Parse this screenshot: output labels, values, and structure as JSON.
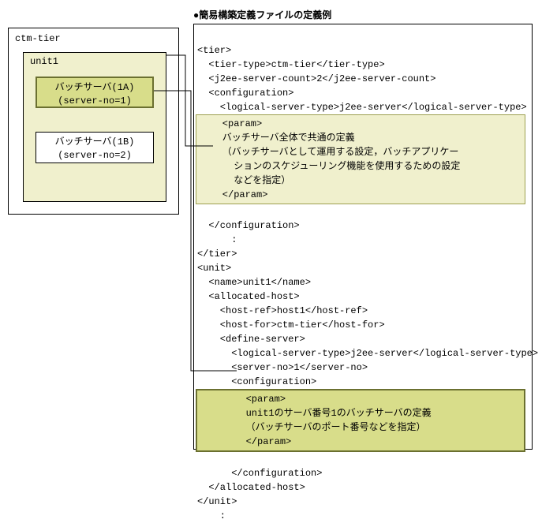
{
  "title": "●簡易構築定義ファイルの定義例",
  "diagram": {
    "ctm_label": "ctm-tier",
    "unit_label": "unit1",
    "server1_line1": "バッチサーバ(1A)",
    "server1_line2": "(server-no=1)",
    "server2_line1": "バッチサーバ(1B)",
    "server2_line2": "(server-no=2)"
  },
  "code": {
    "l01": "<tier>",
    "l02": "  <tier-type>ctm-tier</tier-type>",
    "l03": "  <j2ee-server-count>2</j2ee-server-count>",
    "l04": "  <configuration>",
    "l05": "    <logical-server-type>j2ee-server</logical-server-type>",
    "hl1_a": "    <param>",
    "hl1_b": "    バッチサーバ全体で共通の定義",
    "hl1_c": "    （バッチサーバとして運用する設定，バッチアプリケー",
    "hl1_d": "      ションのスケジューリング機能を使用するための設定",
    "hl1_e": "      などを指定）",
    "hl1_f": "    </param>",
    "l06": "  </configuration>",
    "l07": "      :",
    "l08": "</tier>",
    "l09": "<unit>",
    "l10": "  <name>unit1</name>",
    "l11": "  <allocated-host>",
    "l12": "    <host-ref>host1</host-ref>",
    "l13": "    <host-for>ctm-tier</host-for>",
    "l14": "    <define-server>",
    "l15": "      <logical-server-type>j2ee-server</logical-server-type>",
    "l16": "      <server-no>1</server-no>",
    "l17": "      <configuration>",
    "hl2_a": "        <param>",
    "hl2_b": "        unit1のサーバ番号1のバッチサーバの定義",
    "hl2_c": "        （バッチサーバのポート番号などを指定）",
    "hl2_d": "        </param>",
    "l18": "      </configuration>",
    "l19": "  </allocated-host>",
    "l20": "</unit>",
    "l21": "    :"
  }
}
